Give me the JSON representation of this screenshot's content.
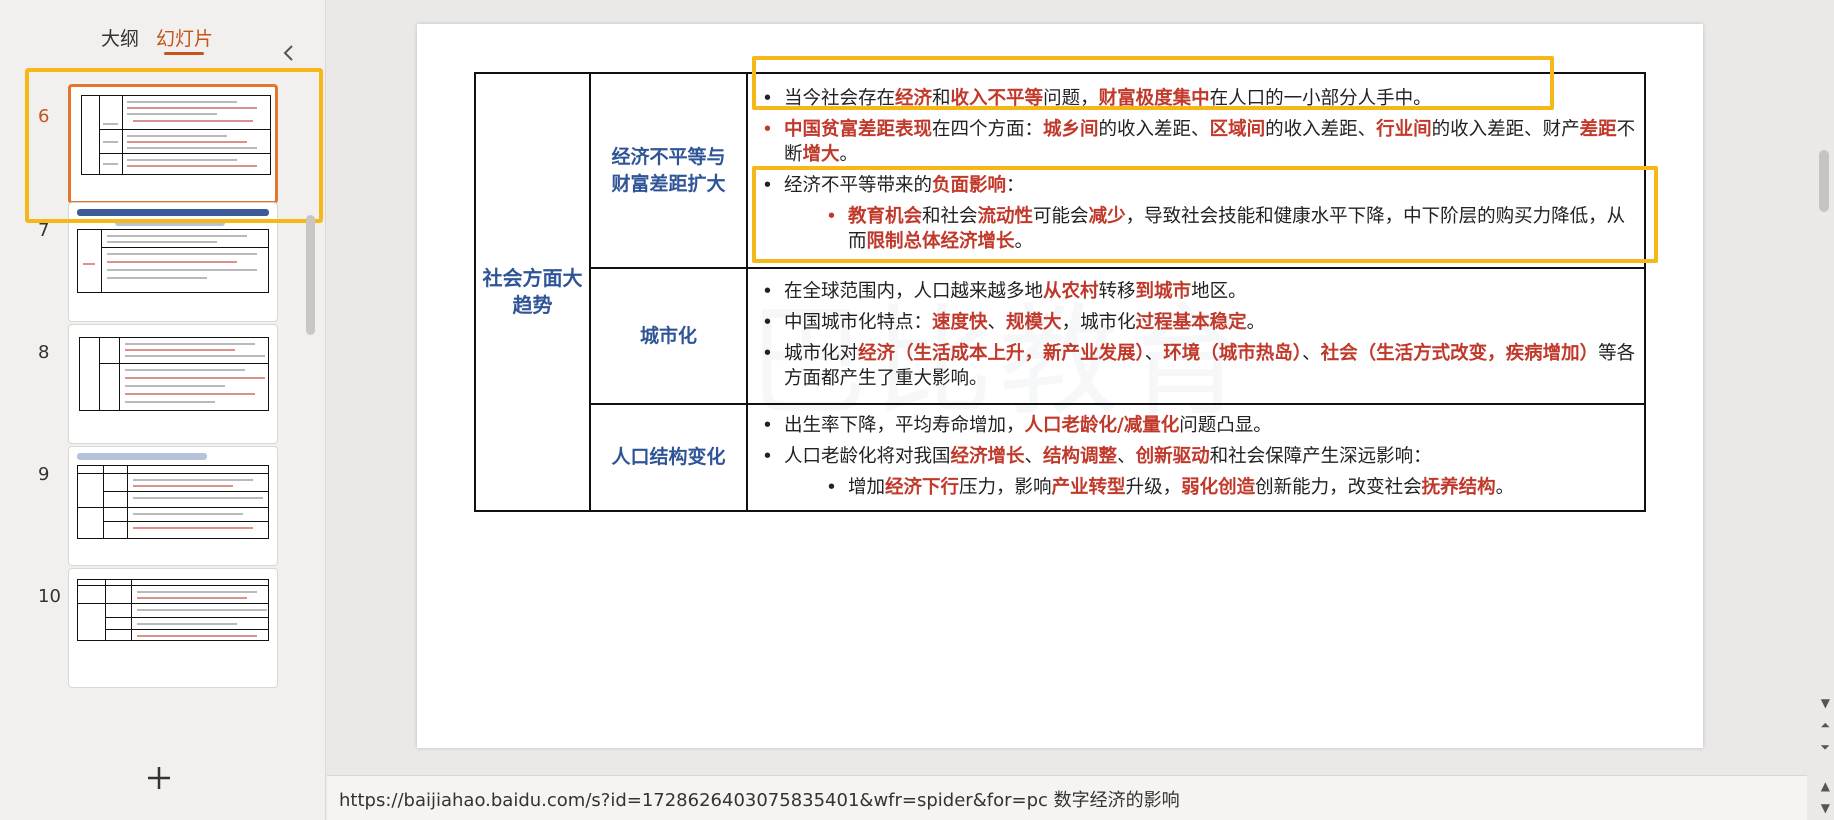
{
  "panel": {
    "tab_outline": "大纲",
    "tab_slides": "幻灯片",
    "collapse_icon": "chevron-left-icon",
    "add_icon": "plus-icon",
    "thumbnails": [
      {
        "num": "6",
        "selected": true
      },
      {
        "num": "7",
        "selected": false
      },
      {
        "num": "8",
        "selected": false
      },
      {
        "num": "9",
        "selected": false
      },
      {
        "num": "10",
        "selected": false
      }
    ]
  },
  "slide": {
    "watermark": "巴比教育",
    "category": "社会方面大趋势",
    "rows": [
      {
        "title": "经济不平等与财富差距扩大",
        "b1": {
          "t1": "当今社会存在",
          "e1": "经济",
          "t2": "和",
          "e2": "收入不平等",
          "t3": "问题，",
          "e3": "财富极度集中",
          "t4": "在人口的一小部分人手中。"
        },
        "b2": {
          "e1": "中国贫富差距表现",
          "t1": "在四个方面：",
          "e2": "城乡间",
          "t2": "的收入差距、",
          "e3": "区域间",
          "t3": "的收入差距、",
          "e4": "行业间",
          "t4": "的收入差距、财产",
          "e5": "差距",
          "t5": "不断",
          "e6": "增大",
          "t6": "。"
        },
        "b3": {
          "t1": "经济不平等带来的",
          "e1": "负面影响",
          "t2": "："
        },
        "b4": {
          "e1": "教育机会",
          "t1": "和社会",
          "e2": "流动性",
          "t2": "可能会",
          "e3": "减少",
          "t3": "，导致社会技能和健康水平下降，中下阶层的购买力降低，从而",
          "e4": "限制总体经济增长",
          "t4": "。"
        }
      },
      {
        "title": "城市化",
        "b1": {
          "t1": "在全球范围内，人口越来越多地",
          "e1": "从农村",
          "t2": "转移",
          "e2": "到城市",
          "t3": "地区。"
        },
        "b2": {
          "t1": "中国城市化特点：",
          "e1": "速度快",
          "t2": "、",
          "e2": "规模大",
          "t3": "，城市化",
          "e3": "过程基本稳定",
          "t4": "。"
        },
        "b3": {
          "t1": "城市化对",
          "e1": "经济（生活成本上升，新产业发展）",
          "t2": "、",
          "e2": "环境（城市热岛）",
          "t3": "、",
          "e3": "社会（生活方式改变，疾病增加）",
          "t4": "等各方面都产生了重大影响。"
        }
      },
      {
        "title": "人口结构变化",
        "b1": {
          "t1": "出生率下降，平均寿命增加，",
          "e1": "人口老龄化/减量化",
          "t2": "问题凸显。"
        },
        "b2": {
          "t1": "人口老龄化将对我国",
          "e1": "经济增长",
          "t2": "、",
          "e2": "结构调整",
          "t3": "、",
          "e3": "创新驱动",
          "t4": "和社会保障产生深远影响："
        },
        "b3": {
          "t1": "增加",
          "e1": "经济下行",
          "t2": "压力，影响",
          "e2": "产业转型",
          "t3": "升级，",
          "e3": "弱化创造",
          "t4": "创新能力，改变社会",
          "e4": "抚养结构",
          "t5": "。"
        }
      }
    ]
  },
  "notes": {
    "text": "https://baijiahao.baidu.com/s?id=1728626403075835401&wfr=spider&for=pc 数字经济的影响"
  },
  "colors": {
    "accent": "#c4531d",
    "highlight": "#f6b818",
    "title_blue": "#2f5597",
    "emphasis_red": "#c0392b"
  }
}
